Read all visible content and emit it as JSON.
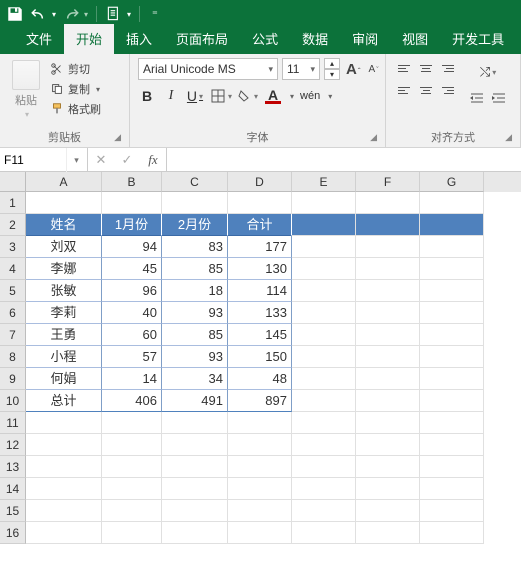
{
  "titlebar": {
    "icons": {
      "save": "save-icon",
      "undo": "undo-icon",
      "redo": "redo-icon",
      "new": "new-doc-icon"
    }
  },
  "menu": {
    "tabs": [
      "文件",
      "开始",
      "插入",
      "页面布局",
      "公式",
      "数据",
      "审阅",
      "视图",
      "开发工具"
    ],
    "active_index": 1
  },
  "ribbon": {
    "clipboard": {
      "paste": "粘贴",
      "cut": "剪切",
      "copy": "复制",
      "format_painter": "格式刷",
      "group_label": "剪贴板"
    },
    "font": {
      "name": "Arial Unicode MS",
      "size": "11",
      "bold": "B",
      "italic": "I",
      "underline": "U",
      "wen": "wén",
      "group_label": "字体"
    },
    "align": {
      "group_label": "对齐方式"
    }
  },
  "formula_bar": {
    "name_box": "F11",
    "cancel": "✕",
    "confirm": "✓",
    "fx": "fx",
    "formula": ""
  },
  "grid": {
    "columns": [
      "A",
      "B",
      "C",
      "D",
      "E",
      "F",
      "G"
    ],
    "row_count": 16,
    "header_row": [
      "姓名",
      "1月份",
      "2月份",
      "合计"
    ],
    "data": [
      {
        "name": "刘双",
        "m1": 94,
        "m2": 83,
        "sum": 177
      },
      {
        "name": "李娜",
        "m1": 45,
        "m2": 85,
        "sum": 130
      },
      {
        "name": "张敏",
        "m1": 96,
        "m2": 18,
        "sum": 114
      },
      {
        "name": "李莉",
        "m1": 40,
        "m2": 93,
        "sum": 133
      },
      {
        "name": "王勇",
        "m1": 60,
        "m2": 85,
        "sum": 145
      },
      {
        "name": "小程",
        "m1": 57,
        "m2": 93,
        "sum": 150
      },
      {
        "name": "何娟",
        "m1": 14,
        "m2": 34,
        "sum": 48
      }
    ],
    "total_row": {
      "name": "总计",
      "m1": 406,
      "m2": 491,
      "sum": 897
    }
  }
}
